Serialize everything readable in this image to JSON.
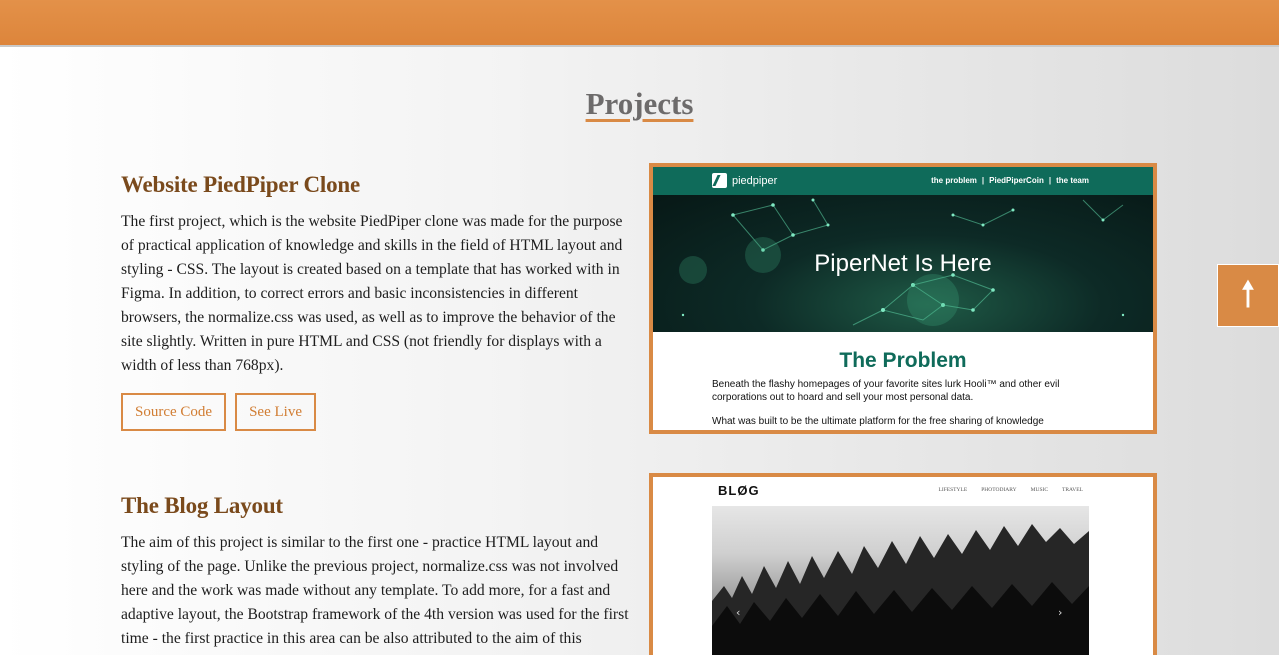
{
  "header": {},
  "page": {
    "title": "Projects"
  },
  "projects": [
    {
      "title": "Website PiedPiper Clone",
      "description": "The first project, which is the website PiedPiper clone was made for the purpose of practical application of knowledge and skills in the field of HTML layout and styling - CSS. The layout is created based on a template that has worked with in Figma. In addition, to correct errors and basic inconsistencies in different browsers, the normalize.css was used, as well as to improve the behavior of the site slightly. Written in pure HTML and CSS (not friendly for displays with a width of less than 768px).",
      "buttons": {
        "source": "Source Code",
        "live": "See Live"
      },
      "preview": {
        "logo": "piedpiper",
        "nav": [
          "the problem",
          "|",
          "PiedPiperCoin",
          "|",
          "the team"
        ],
        "hero_title": "PiperNet Is Here",
        "section_title": "The Problem",
        "text1": "Beneath the flashy homepages of your favorite sites lurk Hooli™ and other evil corporations out to hoard and sell your most personal data.",
        "text2": "What was built to be the ultimate platform for the free sharing of knowledge"
      }
    },
    {
      "title": "The Blog Layout",
      "description": "The aim of this project is similar to the first one - practice HTML layout and styling of the page. Unlike the previous project, normalize.css was not involved here and the work was made without any template. To add more, for a fast and adaptive layout, the Bootstrap framework of the 4th version was used for the first time - the first practice in this area can be also attributed to the aim of this",
      "preview": {
        "logo": "BLØG",
        "nav": [
          "LIFESTYLE",
          "PHOTODIARY",
          "MUSIC",
          "TRAVEL"
        ]
      }
    }
  ],
  "scroll_top": {
    "icon": "arrow-up-icon",
    "glyph": "🠕"
  },
  "colors": {
    "accent": "#d98a45",
    "header": "#e08a41",
    "title_brown": "#7a4a1c",
    "pp_green": "#0f6b5a"
  }
}
